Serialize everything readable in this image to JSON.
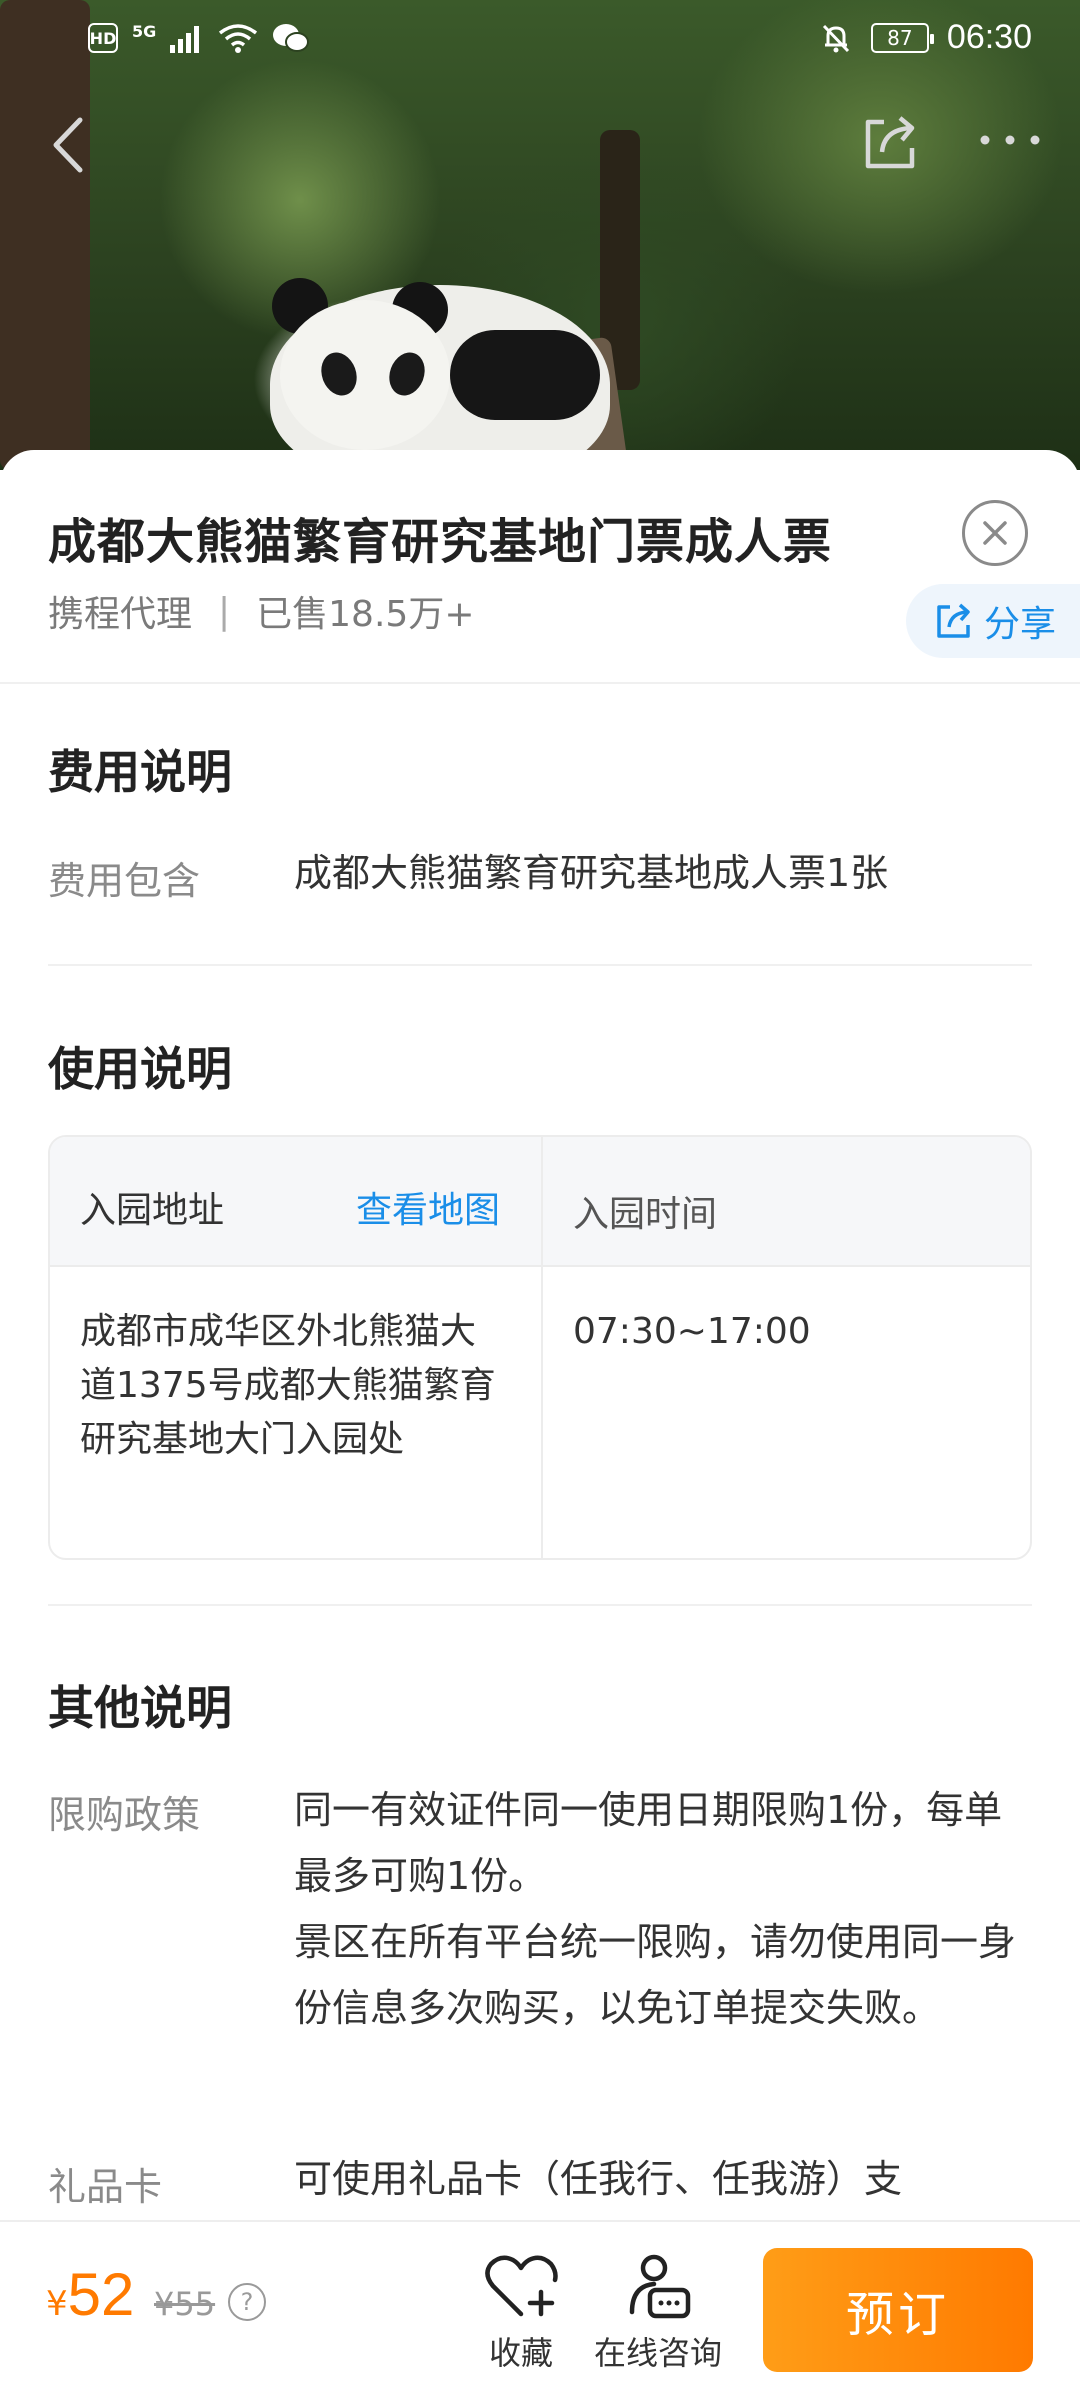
{
  "status_bar": {
    "hd": "HD",
    "network": "5G",
    "battery": "87",
    "time": "06:30"
  },
  "product": {
    "title": "成都大熊猫繁育研究基地门票成人票",
    "agent": "携程代理",
    "separator": "|",
    "sold": "已售18.5万+",
    "share_label": "分享"
  },
  "fees": {
    "section_title": "费用说明",
    "label": "费用包含",
    "value": "成都大熊猫繁育研究基地成人票1张"
  },
  "usage": {
    "section_title": "使用说明",
    "address_header": "入园地址",
    "map_link": "查看地图",
    "time_header": "入园时间",
    "address": "成都市成华区外北熊猫大道1375号成都大熊猫繁育研究基地大门入园处",
    "hours": "07:30~17:00"
  },
  "other": {
    "section_title": "其他说明",
    "purchase_label": "限购政策",
    "purchase_line1": "同一有效证件同一使用日期限购1份，每单最多可购1份。",
    "purchase_line2": "景区在所有平台统一限购，请勿使用同一身份信息多次购买，以免订单提交失败。",
    "giftcard_label": "礼品卡",
    "giftcard_value": "可使用礼品卡（任我行、任我游）支"
  },
  "bottom_bar": {
    "currency": "¥",
    "price": "52",
    "original_price": "¥55",
    "help": "?",
    "favorite_label": "收藏",
    "consult_label": "在线咨询",
    "book_label": "预订"
  },
  "colors": {
    "accent_blue": "#1a8ee8",
    "price_orange": "#ff7a00",
    "button_gradient_start": "#ff9d17",
    "button_gradient_end": "#ff7a00"
  }
}
